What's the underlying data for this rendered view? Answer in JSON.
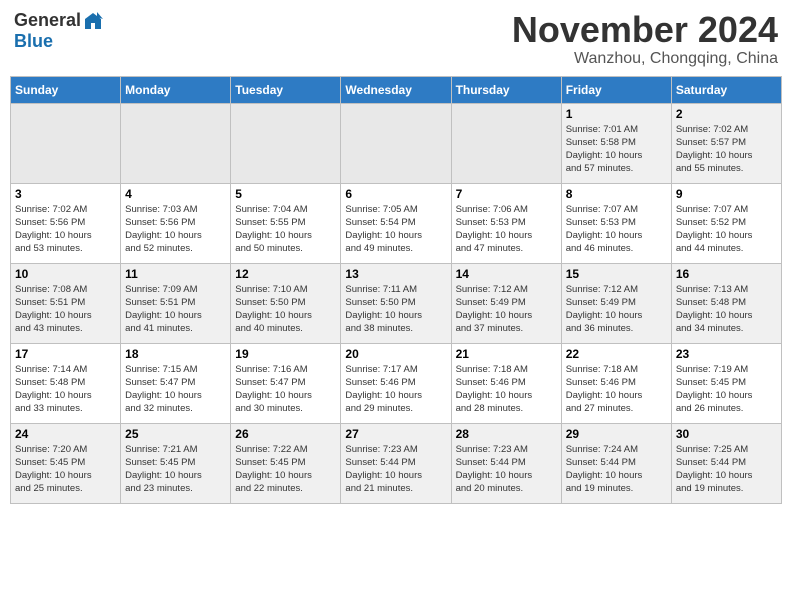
{
  "header": {
    "logo_general": "General",
    "logo_blue": "Blue",
    "month_year": "November 2024",
    "location": "Wanzhou, Chongqing, China"
  },
  "days_of_week": [
    "Sunday",
    "Monday",
    "Tuesday",
    "Wednesday",
    "Thursday",
    "Friday",
    "Saturday"
  ],
  "weeks": [
    [
      {
        "day": "",
        "empty": true
      },
      {
        "day": "",
        "empty": true
      },
      {
        "day": "",
        "empty": true
      },
      {
        "day": "",
        "empty": true
      },
      {
        "day": "",
        "empty": true
      },
      {
        "day": "1",
        "sunrise": "7:01 AM",
        "sunset": "5:58 PM",
        "daylight": "10 hours and 57 minutes."
      },
      {
        "day": "2",
        "sunrise": "7:02 AM",
        "sunset": "5:57 PM",
        "daylight": "10 hours and 55 minutes."
      }
    ],
    [
      {
        "day": "3",
        "sunrise": "7:02 AM",
        "sunset": "5:56 PM",
        "daylight": "10 hours and 53 minutes."
      },
      {
        "day": "4",
        "sunrise": "7:03 AM",
        "sunset": "5:56 PM",
        "daylight": "10 hours and 52 minutes."
      },
      {
        "day": "5",
        "sunrise": "7:04 AM",
        "sunset": "5:55 PM",
        "daylight": "10 hours and 50 minutes."
      },
      {
        "day": "6",
        "sunrise": "7:05 AM",
        "sunset": "5:54 PM",
        "daylight": "10 hours and 49 minutes."
      },
      {
        "day": "7",
        "sunrise": "7:06 AM",
        "sunset": "5:53 PM",
        "daylight": "10 hours and 47 minutes."
      },
      {
        "day": "8",
        "sunrise": "7:07 AM",
        "sunset": "5:53 PM",
        "daylight": "10 hours and 46 minutes."
      },
      {
        "day": "9",
        "sunrise": "7:07 AM",
        "sunset": "5:52 PM",
        "daylight": "10 hours and 44 minutes."
      }
    ],
    [
      {
        "day": "10",
        "sunrise": "7:08 AM",
        "sunset": "5:51 PM",
        "daylight": "10 hours and 43 minutes."
      },
      {
        "day": "11",
        "sunrise": "7:09 AM",
        "sunset": "5:51 PM",
        "daylight": "10 hours and 41 minutes."
      },
      {
        "day": "12",
        "sunrise": "7:10 AM",
        "sunset": "5:50 PM",
        "daylight": "10 hours and 40 minutes."
      },
      {
        "day": "13",
        "sunrise": "7:11 AM",
        "sunset": "5:50 PM",
        "daylight": "10 hours and 38 minutes."
      },
      {
        "day": "14",
        "sunrise": "7:12 AM",
        "sunset": "5:49 PM",
        "daylight": "10 hours and 37 minutes."
      },
      {
        "day": "15",
        "sunrise": "7:12 AM",
        "sunset": "5:49 PM",
        "daylight": "10 hours and 36 minutes."
      },
      {
        "day": "16",
        "sunrise": "7:13 AM",
        "sunset": "5:48 PM",
        "daylight": "10 hours and 34 minutes."
      }
    ],
    [
      {
        "day": "17",
        "sunrise": "7:14 AM",
        "sunset": "5:48 PM",
        "daylight": "10 hours and 33 minutes."
      },
      {
        "day": "18",
        "sunrise": "7:15 AM",
        "sunset": "5:47 PM",
        "daylight": "10 hours and 32 minutes."
      },
      {
        "day": "19",
        "sunrise": "7:16 AM",
        "sunset": "5:47 PM",
        "daylight": "10 hours and 30 minutes."
      },
      {
        "day": "20",
        "sunrise": "7:17 AM",
        "sunset": "5:46 PM",
        "daylight": "10 hours and 29 minutes."
      },
      {
        "day": "21",
        "sunrise": "7:18 AM",
        "sunset": "5:46 PM",
        "daylight": "10 hours and 28 minutes."
      },
      {
        "day": "22",
        "sunrise": "7:18 AM",
        "sunset": "5:46 PM",
        "daylight": "10 hours and 27 minutes."
      },
      {
        "day": "23",
        "sunrise": "7:19 AM",
        "sunset": "5:45 PM",
        "daylight": "10 hours and 26 minutes."
      }
    ],
    [
      {
        "day": "24",
        "sunrise": "7:20 AM",
        "sunset": "5:45 PM",
        "daylight": "10 hours and 25 minutes."
      },
      {
        "day": "25",
        "sunrise": "7:21 AM",
        "sunset": "5:45 PM",
        "daylight": "10 hours and 23 minutes."
      },
      {
        "day": "26",
        "sunrise": "7:22 AM",
        "sunset": "5:45 PM",
        "daylight": "10 hours and 22 minutes."
      },
      {
        "day": "27",
        "sunrise": "7:23 AM",
        "sunset": "5:44 PM",
        "daylight": "10 hours and 21 minutes."
      },
      {
        "day": "28",
        "sunrise": "7:23 AM",
        "sunset": "5:44 PM",
        "daylight": "10 hours and 20 minutes."
      },
      {
        "day": "29",
        "sunrise": "7:24 AM",
        "sunset": "5:44 PM",
        "daylight": "10 hours and 19 minutes."
      },
      {
        "day": "30",
        "sunrise": "7:25 AM",
        "sunset": "5:44 PM",
        "daylight": "10 hours and 19 minutes."
      }
    ]
  ],
  "labels": {
    "sunrise_prefix": "Sunrise: ",
    "sunset_prefix": "Sunset: ",
    "daylight_prefix": "Daylight: "
  }
}
